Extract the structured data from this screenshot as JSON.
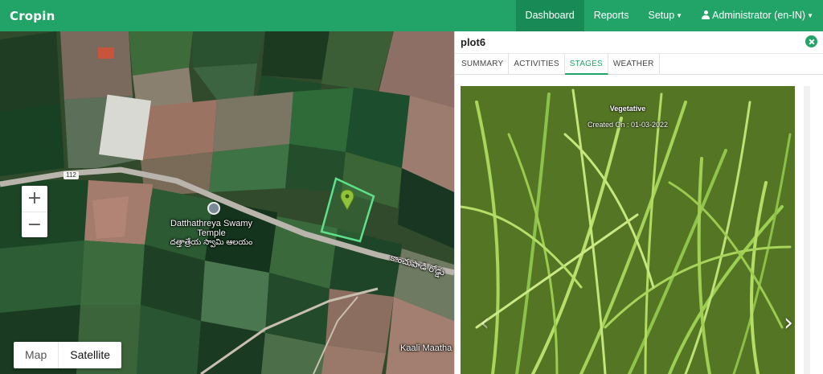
{
  "app": {
    "logo_text": "Cropin",
    "brand_color": "#22a468"
  },
  "nav": {
    "items": [
      {
        "label": "Dashboard",
        "active": true
      },
      {
        "label": "Reports",
        "active": false
      },
      {
        "label": "Setup",
        "active": false,
        "dropdown": true
      },
      {
        "label": "Administrator (en-IN)",
        "active": false,
        "dropdown": true,
        "icon": "user-icon"
      }
    ]
  },
  "map": {
    "zoom_in_label": "+",
    "zoom_out_label": "−",
    "map_types": [
      {
        "label": "Map",
        "selected": false
      },
      {
        "label": "Satellite",
        "selected": true
      }
    ],
    "labels": {
      "temple_en": "Datthathreya Swamy Temple",
      "temple_te": "దత్తాత్రేయ స్వామి ఆలయం",
      "road_te": "కాంచుపాడి రోడ్డు",
      "road_number": "112",
      "place": "Kaali Maatha"
    }
  },
  "panel": {
    "title": "plot6",
    "tabs": [
      {
        "label": "SUMMARY",
        "active": false
      },
      {
        "label": "ACTIVITIES",
        "active": false
      },
      {
        "label": "STAGES",
        "active": true
      },
      {
        "label": "WEATHER",
        "active": false
      }
    ],
    "stage": {
      "name": "Vegetative",
      "created_on": "Created On : 01-03-2022"
    },
    "carousel": {
      "prev_glyph": "‹",
      "next_glyph": "›"
    }
  }
}
